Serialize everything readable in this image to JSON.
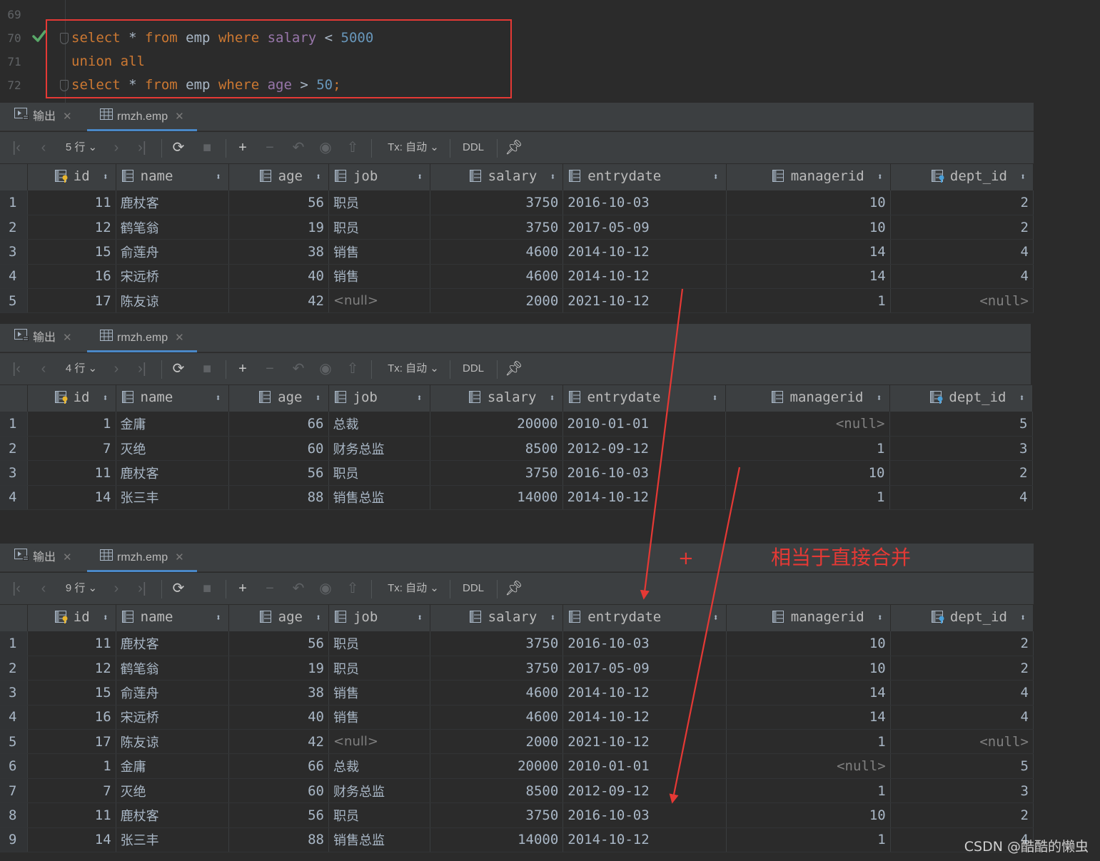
{
  "editor": {
    "line_numbers": [
      "69",
      "70",
      "71",
      "72"
    ],
    "lines": [
      [],
      [
        {
          "t": "select",
          "c": "kw"
        },
        {
          "t": " * ",
          "c": "op"
        },
        {
          "t": "from",
          "c": "kw"
        },
        {
          "t": " emp ",
          "c": "tbl"
        },
        {
          "t": "where",
          "c": "kw"
        },
        {
          "t": " salary",
          "c": "col"
        },
        {
          "t": " < ",
          "c": "op"
        },
        {
          "t": "5000",
          "c": "num"
        }
      ],
      [
        {
          "t": "union all",
          "c": "kw"
        }
      ],
      [
        {
          "t": "select",
          "c": "kw"
        },
        {
          "t": " * ",
          "c": "op"
        },
        {
          "t": "from",
          "c": "kw"
        },
        {
          "t": " emp ",
          "c": "tbl"
        },
        {
          "t": "where",
          "c": "kw"
        },
        {
          "t": " age",
          "c": "col"
        },
        {
          "t": " > ",
          "c": "op"
        },
        {
          "t": "50",
          "c": "num"
        },
        {
          "t": ";",
          "c": "kw"
        }
      ]
    ]
  },
  "tabs": {
    "output": "输出",
    "result": "rmzh.emp"
  },
  "toolbar": {
    "tx": "Tx: 自动",
    "ddl": "DDL"
  },
  "columns": [
    "id",
    "name",
    "age",
    "job",
    "salary",
    "entrydate",
    "managerid",
    "dept_id"
  ],
  "panels": [
    {
      "row_count": "5 行",
      "rows": [
        [
          "1",
          "11",
          "鹿杖客",
          "56",
          "职员",
          "3750",
          "2016-10-03",
          "10",
          "2"
        ],
        [
          "2",
          "12",
          "鹤笔翁",
          "19",
          "职员",
          "3750",
          "2017-05-09",
          "10",
          "2"
        ],
        [
          "3",
          "15",
          "俞莲舟",
          "38",
          "销售",
          "4600",
          "2014-10-12",
          "14",
          "4"
        ],
        [
          "4",
          "16",
          "宋远桥",
          "40",
          "销售",
          "4600",
          "2014-10-12",
          "14",
          "4"
        ],
        [
          "5",
          "17",
          "陈友谅",
          "42",
          "<null>",
          "2000",
          "2021-10-12",
          "1",
          "<null>"
        ]
      ]
    },
    {
      "row_count": "4 行",
      "rows": [
        [
          "1",
          "1",
          "金庸",
          "66",
          "总裁",
          "20000",
          "2010-01-01",
          "<null>",
          "5"
        ],
        [
          "2",
          "7",
          "灭绝",
          "60",
          "财务总监",
          "8500",
          "2012-09-12",
          "1",
          "3"
        ],
        [
          "3",
          "11",
          "鹿杖客",
          "56",
          "职员",
          "3750",
          "2016-10-03",
          "10",
          "2"
        ],
        [
          "4",
          "14",
          "张三丰",
          "88",
          "销售总监",
          "14000",
          "2014-10-12",
          "1",
          "4"
        ]
      ]
    },
    {
      "row_count": "9 行",
      "rows": [
        [
          "1",
          "11",
          "鹿杖客",
          "56",
          "职员",
          "3750",
          "2016-10-03",
          "10",
          "2"
        ],
        [
          "2",
          "12",
          "鹤笔翁",
          "19",
          "职员",
          "3750",
          "2017-05-09",
          "10",
          "2"
        ],
        [
          "3",
          "15",
          "俞莲舟",
          "38",
          "销售",
          "4600",
          "2014-10-12",
          "14",
          "4"
        ],
        [
          "4",
          "16",
          "宋远桥",
          "40",
          "销售",
          "4600",
          "2014-10-12",
          "14",
          "4"
        ],
        [
          "5",
          "17",
          "陈友谅",
          "42",
          "<null>",
          "2000",
          "2021-10-12",
          "1",
          "<null>"
        ],
        [
          "6",
          "1",
          "金庸",
          "66",
          "总裁",
          "20000",
          "2010-01-01",
          "<null>",
          "5"
        ],
        [
          "7",
          "7",
          "灭绝",
          "60",
          "财务总监",
          "8500",
          "2012-09-12",
          "1",
          "3"
        ],
        [
          "8",
          "11",
          "鹿杖客",
          "56",
          "职员",
          "3750",
          "2016-10-03",
          "10",
          "2"
        ],
        [
          "9",
          "14",
          "张三丰",
          "88",
          "销售总监",
          "14000",
          "2014-10-12",
          "1",
          "4"
        ]
      ]
    }
  ],
  "annotations": {
    "plus": "+",
    "caption": "相当于直接合并",
    "color": "#e53935"
  },
  "watermark": "CSDN @酷酷的懒虫"
}
